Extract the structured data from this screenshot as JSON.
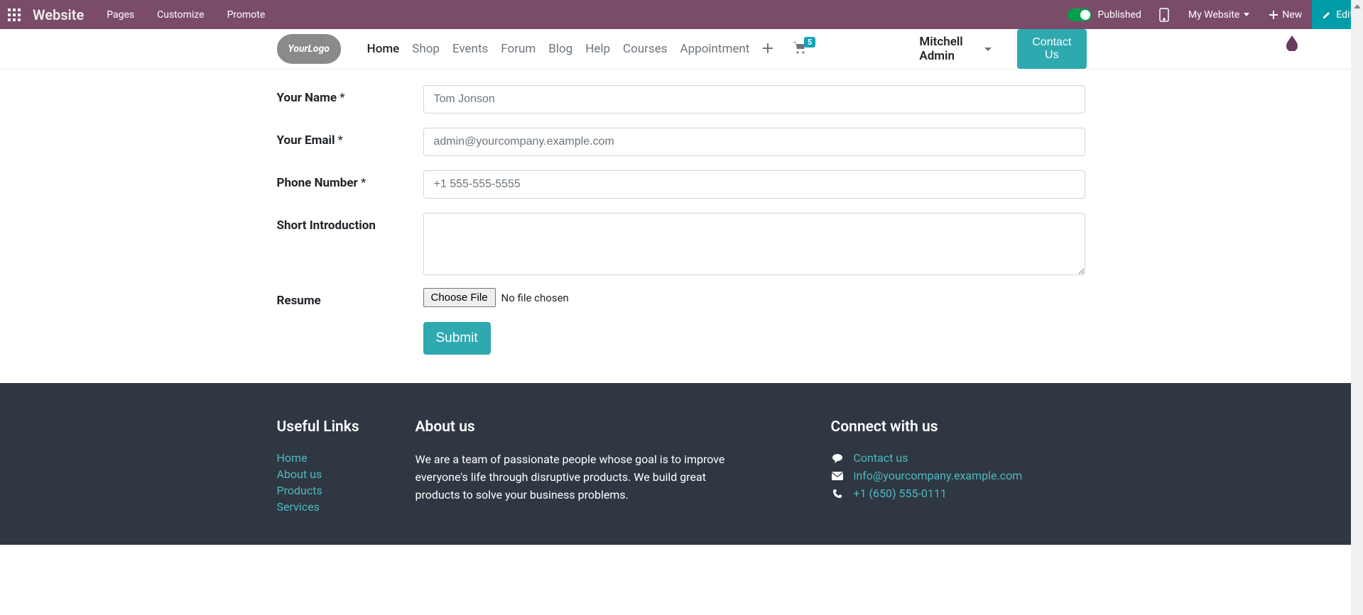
{
  "topbar": {
    "brand": "Website",
    "links": [
      "Pages",
      "Customize",
      "Promote"
    ],
    "published_label": "Published",
    "my_website_label": "My Website",
    "new_label": "New",
    "edit_label": "Edit"
  },
  "header": {
    "logo_text": "YourLogo",
    "nav": [
      "Home",
      "Shop",
      "Events",
      "Forum",
      "Blog",
      "Help",
      "Courses",
      "Appointment"
    ],
    "cart_count": "5",
    "user_name": "Mitchell Admin",
    "contact_label": "Contact Us"
  },
  "form": {
    "fields": {
      "name_label": "Your Name",
      "name_value": "Tom Jonson",
      "email_label": "Your Email",
      "email_value": "admin@yourcompany.example.com",
      "phone_label": "Phone Number",
      "phone_value": "+1 555-555-5555",
      "intro_label": "Short Introduction",
      "intro_value": "",
      "resume_label": "Resume",
      "choose_file": "Choose File",
      "no_file": "No file chosen"
    },
    "required_mark": "*",
    "submit_label": "Submit"
  },
  "footer": {
    "links_title": "Useful Links",
    "links": [
      "Home",
      "About us",
      "Products",
      "Services"
    ],
    "about_title": "About us",
    "about_text": "We are a team of passionate people whose goal is to improve everyone's life through disruptive products. We build great products to solve your business problems.",
    "connect_title": "Connect with us",
    "connect_contact": "Contact us",
    "connect_email": "info@yourcompany.example.com",
    "connect_phone": "+1 (650) 555-0111"
  }
}
